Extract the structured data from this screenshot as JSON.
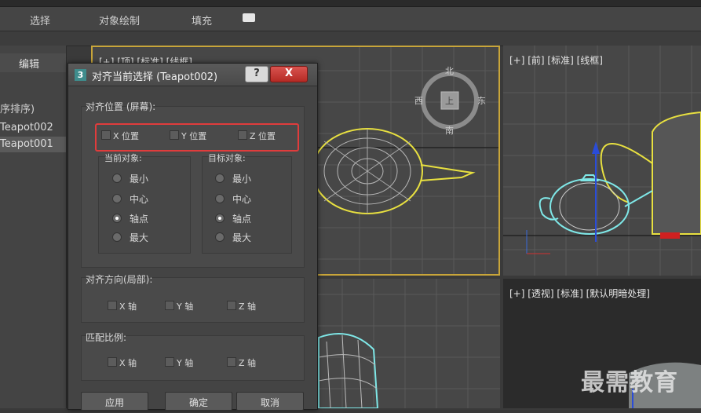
{
  "ribbon": {
    "tabs": [
      "选择",
      "对象绘制",
      "填充"
    ]
  },
  "explorer": {
    "header": "编辑",
    "sort_label": "序排序)",
    "items": [
      "Teapot002",
      "Teapot001"
    ]
  },
  "viewports": {
    "top_label": "[+] [顶] [标准] [线框]",
    "front_label": "[+] [前] [标准] [线框]",
    "persp_label": "[+] [透视] [标准] [默认明暗处理]",
    "viewcube": {
      "north": "北",
      "south": "南",
      "west": "西",
      "east": "东",
      "face": "上"
    }
  },
  "dialog": {
    "icon": "3",
    "title": "对齐当前选择 (Teapot002)",
    "help": "?",
    "close": "X",
    "align_position": {
      "label": "对齐位置 (屏幕):",
      "x": "X 位置",
      "y": "Y 位置",
      "z": "Z 位置"
    },
    "current_object": {
      "label": "当前对象:",
      "options": [
        "最小",
        "中心",
        "轴点",
        "最大"
      ],
      "selected": "轴点"
    },
    "target_object": {
      "label": "目标对象:",
      "options": [
        "最小",
        "中心",
        "轴点",
        "最大"
      ],
      "selected": "轴点"
    },
    "align_orientation": {
      "label": "对齐方向(局部):",
      "x": "X 轴",
      "y": "Y 轴",
      "z": "Z 轴"
    },
    "match_scale": {
      "label": "匹配比例:",
      "x": "X 轴",
      "y": "Y 轴",
      "z": "Z 轴"
    },
    "buttons": {
      "apply": "应用",
      "ok": "确定",
      "cancel": "取消"
    }
  },
  "watermark": "最需教育",
  "colors": {
    "accent_highlight": "#e03c3c",
    "selection_yellow": "#e8e040",
    "wire_cyan": "#7fe8e8"
  }
}
